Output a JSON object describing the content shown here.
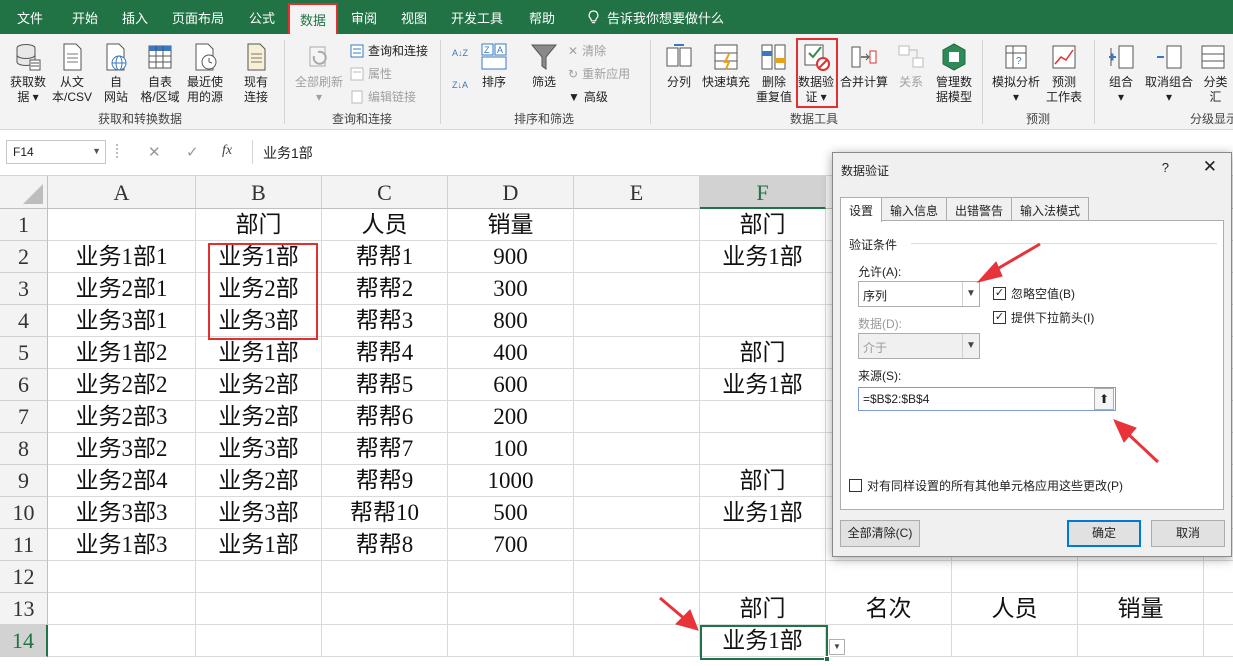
{
  "menu": {
    "tabs": [
      "文件",
      "开始",
      "插入",
      "页面布局",
      "公式",
      "数据",
      "审阅",
      "视图",
      "开发工具",
      "帮助"
    ],
    "active_tab": "数据",
    "tell_me": "告诉我你想要做什么"
  },
  "ribbon": {
    "get_data": {
      "label_1": "获取数",
      "label_2": "据 ▾"
    },
    "from_text": {
      "label_1": "从文",
      "label_2": "本/CSV"
    },
    "from_web": {
      "label_1": "自",
      "label_2": "网站"
    },
    "from_table": {
      "label_1": "自表",
      "label_2": "格/区域"
    },
    "recent_sources": {
      "label_1": "最近使",
      "label_2": "用的源"
    },
    "existing_conn": {
      "label_1": "现有",
      "label_2": "连接"
    },
    "group_get": "获取和转换数据",
    "refresh_all": {
      "label_1": "全部刷新",
      "label_2": "▾"
    },
    "queries_conn": "查询和连接",
    "properties": "属性",
    "edit_links": "编辑链接",
    "group_queries": "查询和连接",
    "sort_az": "A↓Z",
    "sort_za": "Z↓A",
    "sort": "排序",
    "filter": "筛选",
    "clear": "清除",
    "reapply": "重新应用",
    "advanced": "高级",
    "group_sort": "排序和筛选",
    "text_to_cols": "分列",
    "flash_fill": "快速填充",
    "remove_dup": {
      "label_1": "删除",
      "label_2": "重复值"
    },
    "data_validation": {
      "label_1": "数据验",
      "label_2": "证 ▾"
    },
    "consolidate": "合并计算",
    "relationships": "关系",
    "manage_model": {
      "label_1": "管理数",
      "label_2": "据模型"
    },
    "group_tools": "数据工具",
    "whatif": {
      "label_1": "模拟分析",
      "label_2": "▾"
    },
    "forecast": {
      "label_1": "预测",
      "label_2": "工作表"
    },
    "group_forecast": "预测",
    "group_btn": {
      "label_1": "组合",
      "label_2": "▾"
    },
    "ungroup": {
      "label_1": "取消组合",
      "label_2": "▾"
    },
    "subtotal": "分类汇",
    "group_outline": "分级显示"
  },
  "formula_bar": {
    "name_box": "F14",
    "cancel_icon": "✕",
    "enter_icon": "✓",
    "fx": "fx",
    "content": "业务1部"
  },
  "sheet": {
    "columns": [
      "A",
      "B",
      "C",
      "D",
      "E",
      "F"
    ],
    "rows": [
      "1",
      "2",
      "3",
      "4",
      "5",
      "6",
      "7",
      "8",
      "9",
      "10",
      "11",
      "12",
      "13",
      "14"
    ],
    "cells": {
      "B1": "部门",
      "C1": "人员",
      "D1": "销量",
      "F1": "部门",
      "A2": "业务1部1",
      "B2": "业务1部",
      "C2": "帮帮1",
      "D2": "900",
      "F2": "业务1部",
      "A3": "业务2部1",
      "B3": "业务2部",
      "C3": "帮帮2",
      "D3": "300",
      "A4": "业务3部1",
      "B4": "业务3部",
      "C4": "帮帮3",
      "D4": "800",
      "A5": "业务1部2",
      "B5": "业务1部",
      "C5": "帮帮4",
      "D5": "400",
      "F5": "部门",
      "A6": "业务2部2",
      "B6": "业务2部",
      "C6": "帮帮5",
      "D6": "600",
      "F6": "业务1部",
      "A7": "业务2部3",
      "B7": "业务2部",
      "C7": "帮帮6",
      "D7": "200",
      "A8": "业务3部2",
      "B8": "业务3部",
      "C8": "帮帮7",
      "D8": "100",
      "A9": "业务2部4",
      "B9": "业务2部",
      "C9": "帮帮9",
      "D9": "1000",
      "F9": "部门",
      "A10": "业务3部3",
      "B10": "业务3部",
      "C10": "帮帮10",
      "D10": "500",
      "F10": "业务1部",
      "A11": "业务1部3",
      "B11": "业务1部",
      "C11": "帮帮8",
      "D11": "700",
      "F13": "部门",
      "G13": "名次",
      "H13": "人员",
      "I13": "销量",
      "F14": "业务1部"
    },
    "active_cell": "F14"
  },
  "dialog": {
    "title": "数据验证",
    "help": "?",
    "close": "✕",
    "tabs": [
      "设置",
      "输入信息",
      "出错警告",
      "输入法模式"
    ],
    "active_tab": "设置",
    "section_title": "验证条件",
    "allow_label": "允许(A):",
    "allow_value": "序列",
    "ignore_blank": "忽略空值(B)",
    "ignore_blank_checked": true,
    "dropdown_arrow": "提供下拉箭头(I)",
    "dropdown_arrow_checked": true,
    "data_label": "数据(D):",
    "data_value": "介于",
    "source_label": "来源(S):",
    "source_value": "=$B$2:$B$4",
    "apply_all": "对有同样设置的所有其他单元格应用这些更改(P)",
    "apply_all_checked": false,
    "clear_all": "全部清除(C)",
    "ok": "确定",
    "cancel": "取消"
  },
  "colors": {
    "excel_green": "#217346",
    "highlight_red": "#e03030",
    "arrow_red": "#e8333a",
    "dialog_bg": "#f0f0f0"
  }
}
